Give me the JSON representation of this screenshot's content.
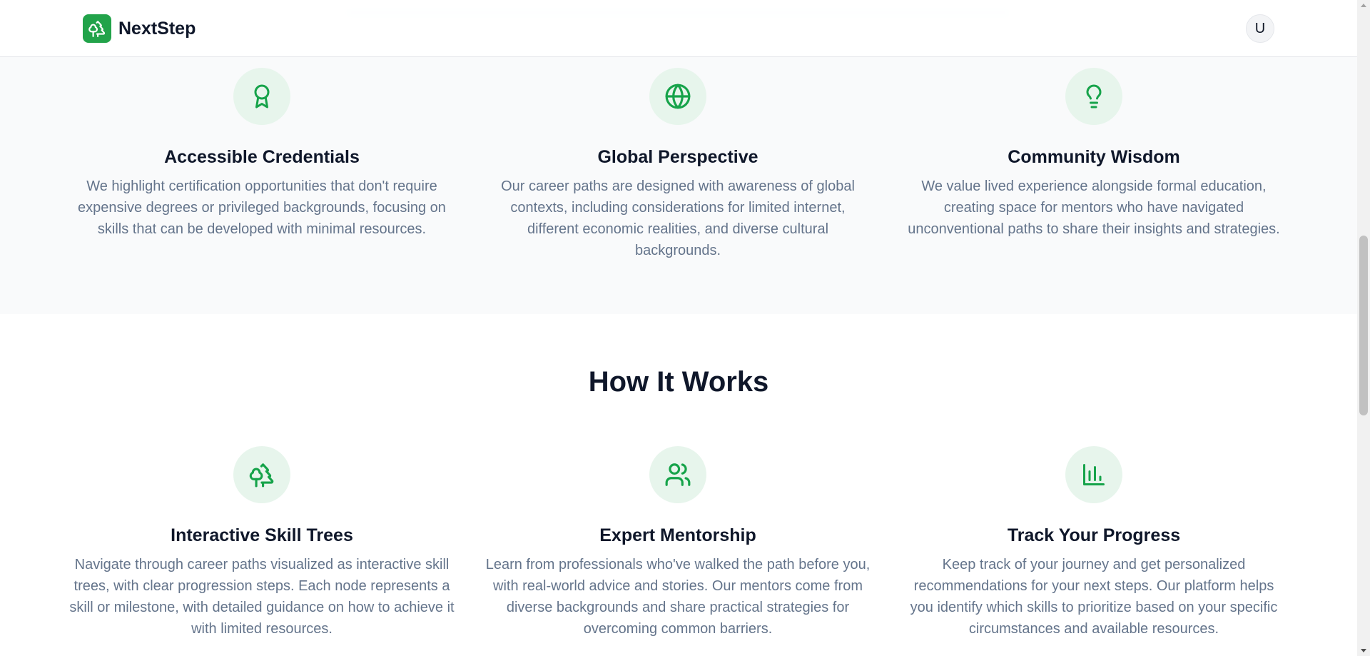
{
  "app": {
    "brand_name": "NextStep",
    "brand_color": "#22a34a",
    "user_initial": "U"
  },
  "values": [
    {
      "icon": "award-icon",
      "title": "Accessible Credentials",
      "text": "We highlight certification opportunities that don't require expensive degrees or privileged backgrounds, focusing on skills that can be developed with minimal resources."
    },
    {
      "icon": "globe-icon",
      "title": "Global Perspective",
      "text": "Our career paths are designed with awareness of global contexts, including considerations for limited internet, different economic realities, and diverse cultural backgrounds."
    },
    {
      "icon": "lightbulb-icon",
      "title": "Community Wisdom",
      "text": "We value lived experience alongside formal education, creating space for mentors who have navigated unconventional paths to share their insights and strategies."
    }
  ],
  "how_it_works": {
    "title": "How It Works",
    "features": [
      {
        "icon": "trees-icon",
        "title": "Interactive Skill Trees",
        "text": "Navigate through career paths visualized as interactive skill trees, with clear progression steps. Each node represents a skill or milestone, with detailed guidance on how to achieve it with limited resources."
      },
      {
        "icon": "users-icon",
        "title": "Expert Mentorship",
        "text": "Learn from professionals who've walked the path before you, with real-world advice and stories. Our mentors come from diverse backgrounds and share practical strategies for overcoming common barriers."
      },
      {
        "icon": "bar-chart-icon",
        "title": "Track Your Progress",
        "text": "Keep track of your journey and get personalized recommendations for your next steps. Our platform helps you identify which skills to prioritize based on your specific circumstances and available resources."
      }
    ]
  }
}
